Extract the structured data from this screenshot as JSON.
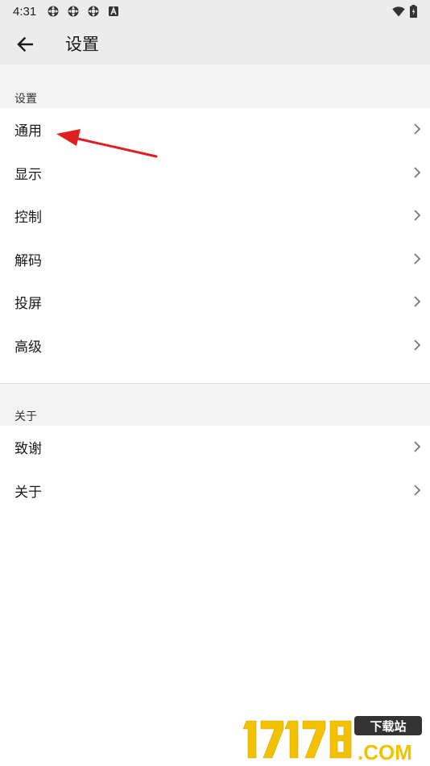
{
  "status_bar": {
    "time": "4:31",
    "icons": [
      "app-notification-icon",
      "app-notification-icon",
      "app-notification-icon",
      "a-notification-icon"
    ],
    "right_icons": [
      "wifi-icon",
      "battery-icon"
    ]
  },
  "app_bar": {
    "back_icon": "arrow-left-icon",
    "title": "设置"
  },
  "sections": [
    {
      "header": "设置",
      "items": [
        {
          "label": "通用"
        },
        {
          "label": "显示"
        },
        {
          "label": "控制"
        },
        {
          "label": "解码"
        },
        {
          "label": "投屏"
        },
        {
          "label": "高级"
        }
      ]
    },
    {
      "header": "关于",
      "items": [
        {
          "label": "致谢"
        },
        {
          "label": "关于"
        }
      ]
    }
  ],
  "annotation": {
    "color": "#e02020"
  },
  "watermark": {
    "brand": "17178",
    "tag": "下载站",
    "domain": ".COM",
    "color": "#f2c200"
  }
}
